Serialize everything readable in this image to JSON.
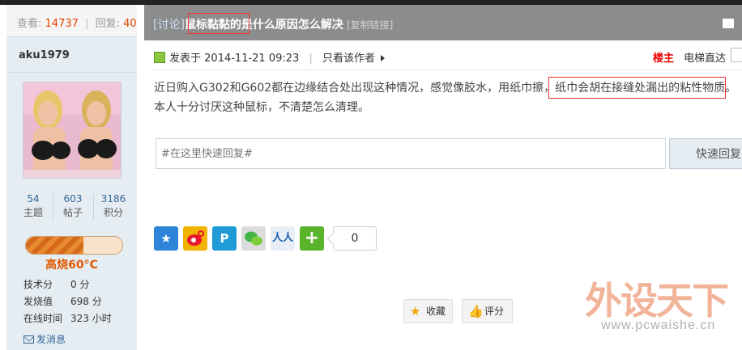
{
  "stats": {
    "views_label": "查看:",
    "views": "14737",
    "replies_label": "回复:",
    "replies": "40"
  },
  "user": {
    "name": "aku1979",
    "counts": [
      {
        "value": "54",
        "label": "主题"
      },
      {
        "value": "603",
        "label": "帖子"
      },
      {
        "value": "3186",
        "label": "积分"
      }
    ],
    "heat_level": 0.6,
    "heat_label": "高烧60°C",
    "details": [
      {
        "key": "技术分",
        "value": "0 分"
      },
      {
        "key": "发烧值",
        "value": "698 分"
      },
      {
        "key": "在线时间",
        "value": "323 小时"
      }
    ],
    "send_message": "发消息"
  },
  "thread": {
    "category": "[讨论]",
    "title": "鼠标黏黏的是什么原因怎么解决",
    "copy_link": "[复制链接]"
  },
  "post": {
    "posted_prefix": "发表于",
    "posted_time": "2014-11-21 09:23",
    "author_only": "只看该作者",
    "floor_label": "楼主",
    "elevator_label": "电梯直达",
    "content_line1": "近日购入G302和G602都在边缘结合处出现这种情况，感觉像胶水，用纸巾擦，纸巾会胡在接缝处漏出的粘性物质。",
    "content_line2": "本人十分讨厌这种鼠标，不清楚怎么清理。"
  },
  "reply": {
    "placeholder": "#在这里快速回复#",
    "button": "快速回复"
  },
  "share": {
    "icons": [
      "qzone-icon",
      "weibo-icon",
      "tencent-weibo-icon",
      "wechat-icon",
      "renren-icon",
      "more-share-icon"
    ],
    "count": "0"
  },
  "actions": {
    "favorite": "收藏",
    "rate": "评分"
  },
  "watermark": {
    "brand": "外设天下",
    "url": "www.pcwaishe.cn"
  },
  "colors": {
    "title_bar": "#8c8c8c",
    "left_column": "#e5edf2",
    "floor_label": "#ee0000",
    "heat": "#e05a00",
    "link": "#336699",
    "highlight_box": "#ee3333"
  }
}
